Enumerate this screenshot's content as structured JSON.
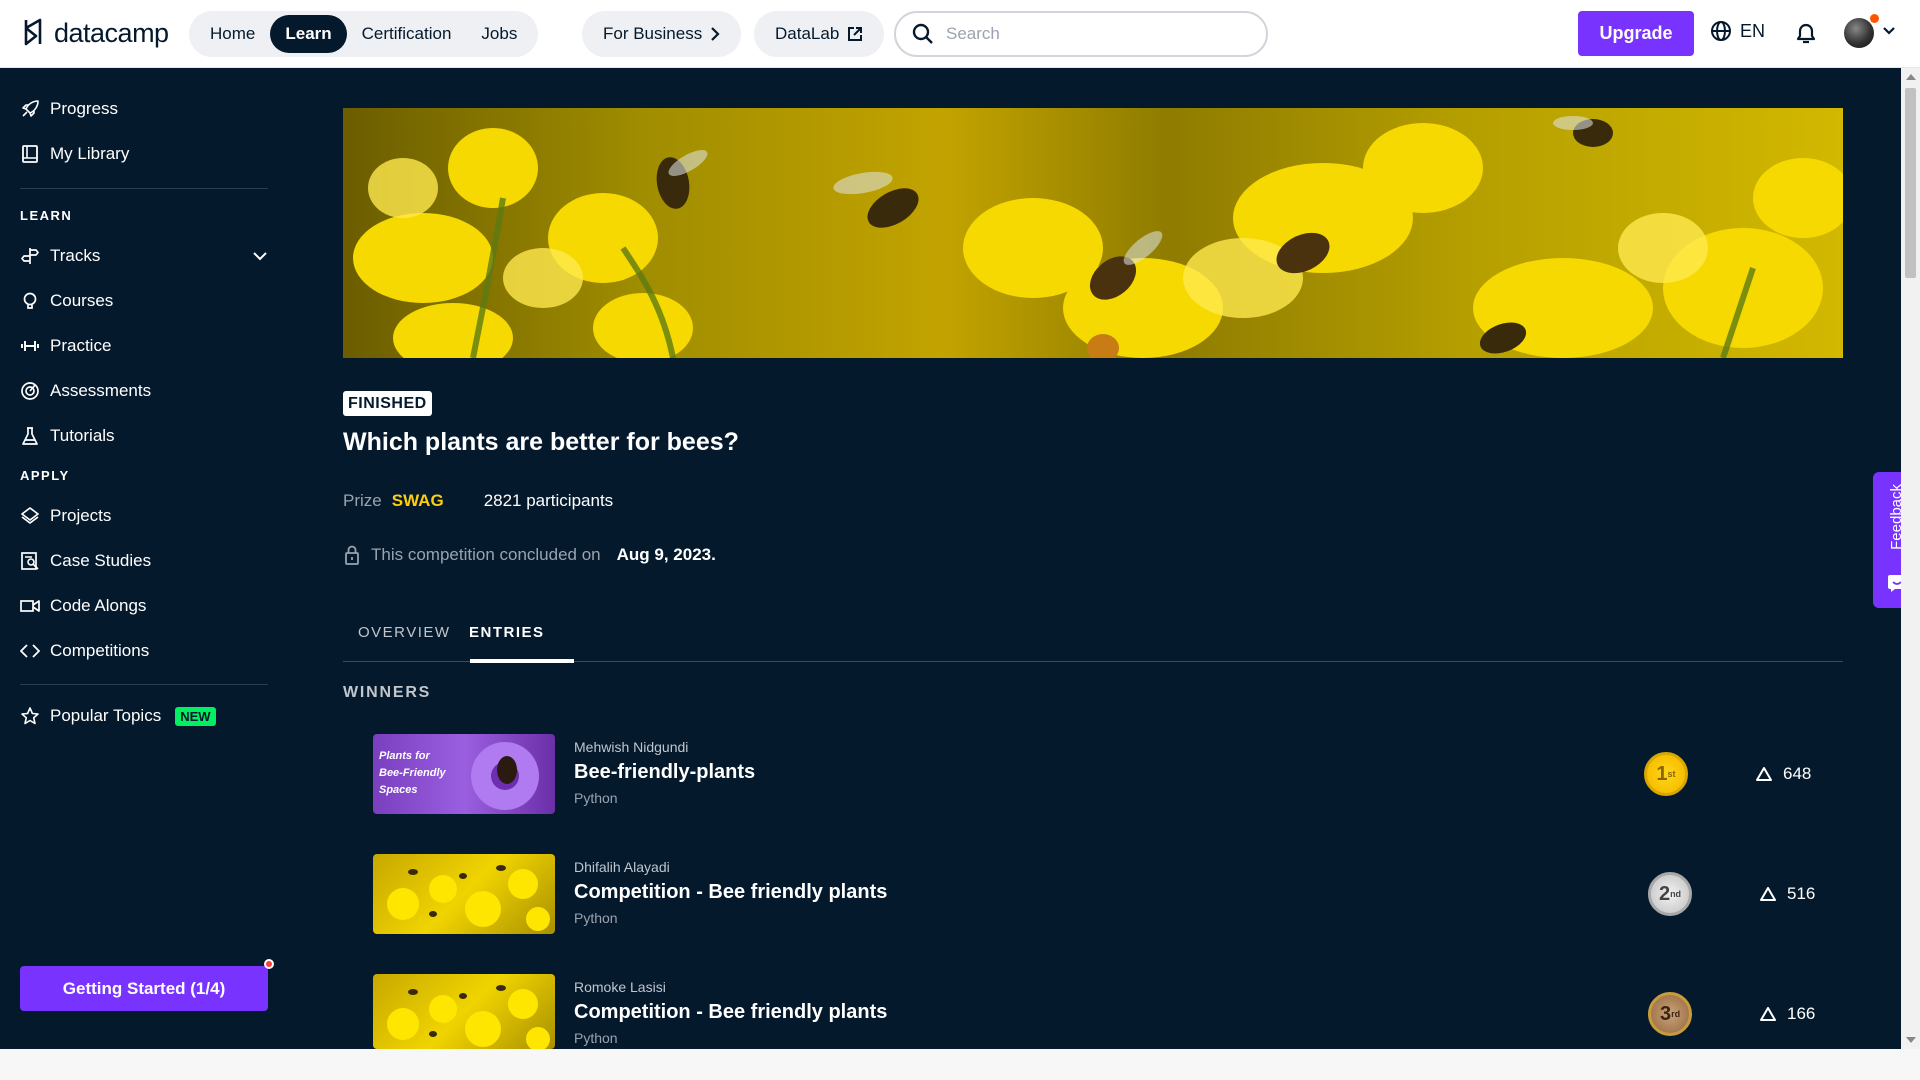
{
  "topbar": {
    "logo_text": "datacamp",
    "nav": [
      {
        "label": "Home",
        "active": false
      },
      {
        "label": "Learn",
        "active": true
      },
      {
        "label": "Certification",
        "active": false
      },
      {
        "label": "Jobs",
        "active": false
      }
    ],
    "for_business": "For Business",
    "datalab": "DataLab",
    "search_placeholder": "Search",
    "upgrade": "Upgrade",
    "language": "EN"
  },
  "sidebar": {
    "progress": "Progress",
    "my_library": "My Library",
    "learn_heading": "LEARN",
    "tracks": "Tracks",
    "courses": "Courses",
    "practice": "Practice",
    "assessments": "Assessments",
    "tutorials": "Tutorials",
    "apply_heading": "APPLY",
    "projects": "Projects",
    "case_studies": "Case Studies",
    "code_alongs": "Code Alongs",
    "competitions": "Competitions",
    "popular_topics": "Popular Topics",
    "new_badge": "NEW",
    "getting_started": "Getting Started (1/4)"
  },
  "competition": {
    "status": "FINISHED",
    "title": "Which plants are better for bees?",
    "prize_label": "Prize",
    "prize_value": "SWAG",
    "participants": "2821 participants",
    "concluded_text": "This competition concluded on",
    "concluded_date": "Aug 9, 2023."
  },
  "tabs": {
    "overview": "OVERVIEW",
    "entries": "ENTRIES"
  },
  "winners_heading": "WINNERS",
  "entries": [
    {
      "author": "Mehwish Nidgundi",
      "title": "Bee-friendly-plants",
      "language": "Python",
      "rank": "1",
      "rank_suffix": "st",
      "votes": "648",
      "thumb_caption": "Plants for Bee-Friendly Spaces"
    },
    {
      "author": "Dhifalih Alayadi",
      "title": "Competition - Bee friendly plants",
      "language": "Python",
      "rank": "2",
      "rank_suffix": "nd",
      "votes": "516"
    },
    {
      "author": "Romoke Lasisi",
      "title": "Competition - Bee friendly plants",
      "language": "Python",
      "rank": "3",
      "rank_suffix": "rd",
      "votes": "166"
    }
  ],
  "feedback": "Feedback",
  "colors": {
    "background": "#05192d",
    "accent": "#7933ff",
    "prize": "#fcce0d",
    "new_badge": "#03ef62"
  }
}
